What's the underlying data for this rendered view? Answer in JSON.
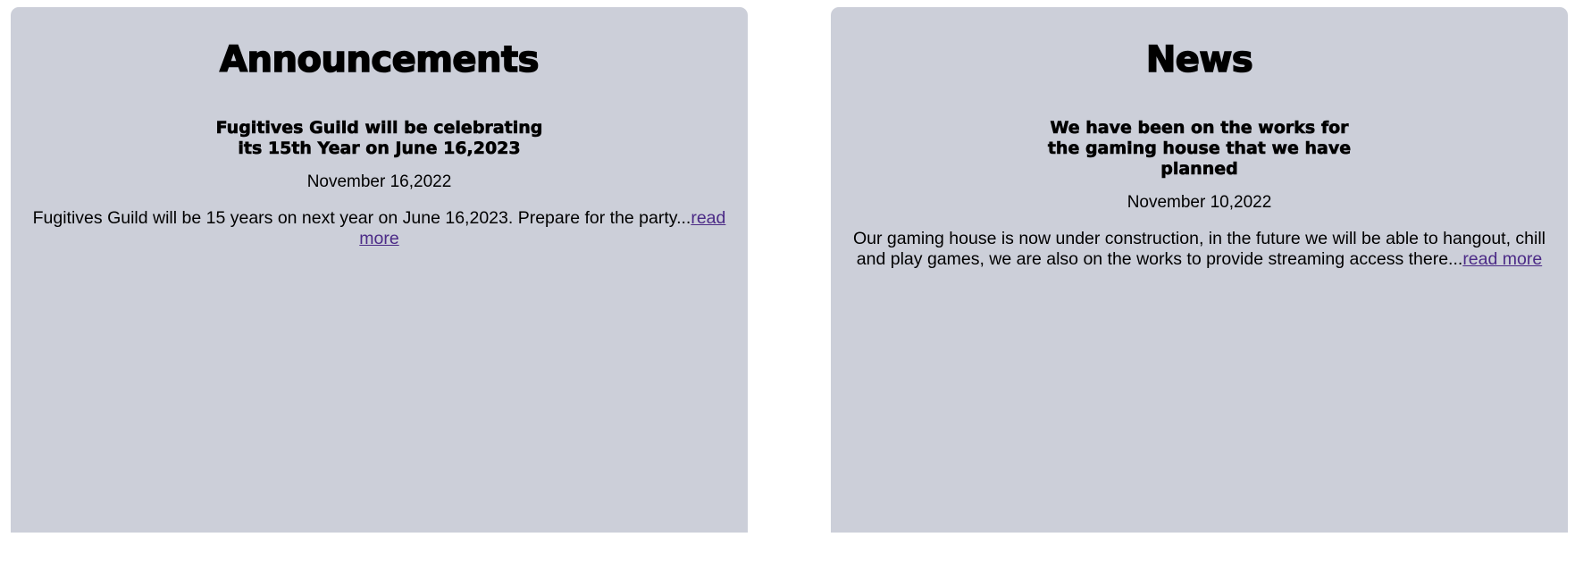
{
  "announcements": {
    "title": "Announcements",
    "headline": "Fugitives Guild will be celebrating its 15th Year on June 16,2023",
    "date": "November 16,2022",
    "excerpt": "Fugitives Guild will be 15 years on next year on June 16,2023. Prepare for the party...",
    "read_more": "read more"
  },
  "news": {
    "title": "News",
    "headline": "We have been on the works for the gaming house that we have planned",
    "date": "November 10,2022",
    "excerpt": "Our gaming house is now under construction, in the future we will be able to hangout, chill and play games, we are also on the works to provide streaming access there...",
    "read_more": "read more"
  },
  "colors": {
    "panel_background": "#cccfd9",
    "link": "#4b2a86",
    "text": "#000000"
  }
}
